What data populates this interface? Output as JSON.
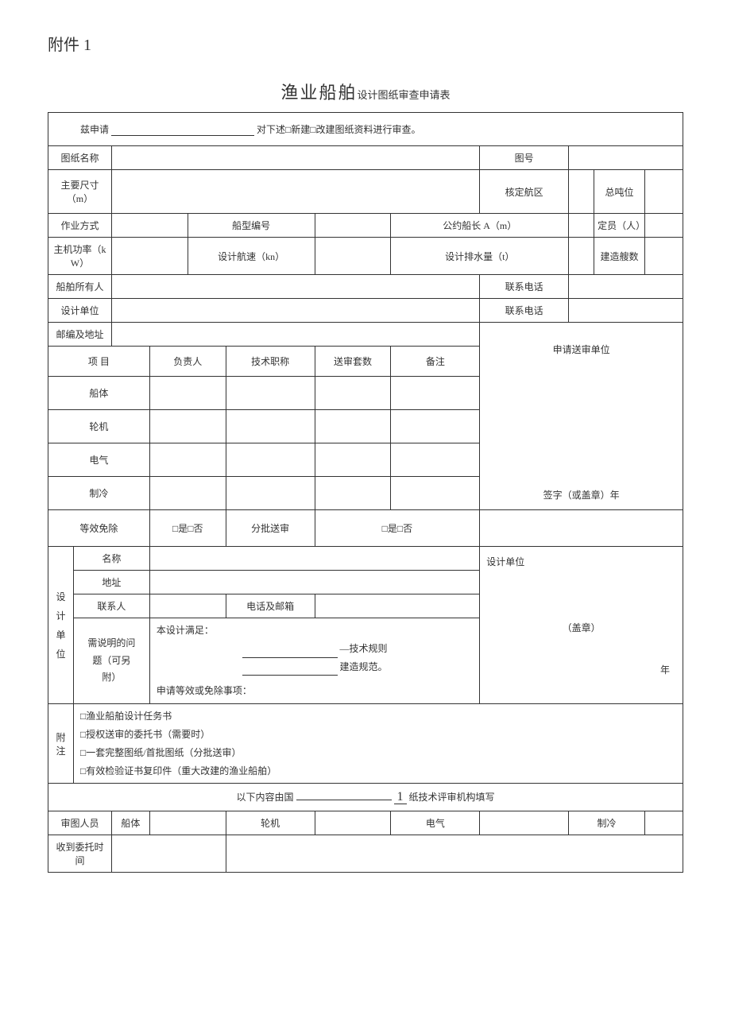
{
  "attachment": "附件 1",
  "title_main": "渔业船舶",
  "title_sub": "设计图纸审查申请表",
  "intro_prefix": "兹申请",
  "intro_suffix": "对下述□新建□改建图纸资料进行审查。",
  "labels": {
    "drawing_name": "图纸名称",
    "drawing_no": "图号",
    "main_dims": "主要尺寸（m）",
    "nav_area": "核定航区",
    "gross_tonnage": "总吨位",
    "work_mode": "作业方式",
    "ship_type_code": "船型编号",
    "convention_length": "公约船长 A（m）",
    "crew": "定员（人）",
    "main_power": "主机功率（kW）",
    "design_speed": "设计航速（kn）",
    "design_displacement": "设计排水量（t）",
    "build_count": "建造艘数",
    "ship_owner": "船舶所有人",
    "contact_phone": "联系电话",
    "design_unit": "设计单位",
    "post_addr": "邮编及地址",
    "item": "项    目",
    "responsible": "负责人",
    "tech_title": "技术职称",
    "review_sets": "送审套数",
    "remark": "备注",
    "hull": "船体",
    "engine": "轮机",
    "electric": "电气",
    "refrig": "制冷",
    "equiv_exempt": "等效免除",
    "yes_no": "□是□否",
    "batch_review": "分批送审",
    "applicant_unit": "申请送审单位",
    "sign_seal": "签字（或盖章）年",
    "design_unit_block": "设计\n单位",
    "name": "名称",
    "addr": "地址",
    "contact": "联系人",
    "phone_email": "电话及邮箱",
    "need_explain": "需说明的问题（可另附）",
    "design_meet": "本设计满足：",
    "tech_rule": "—技术规则",
    "build_spec": "建造规范。",
    "apply_equiv": "申请等效或免除事项：",
    "design_unit_right": "设计单位",
    "seal": "（盖章）",
    "year": "年",
    "attach": "附注",
    "attach1": "□渔业船舶设计任务书",
    "attach2": "□授权送审的委托书（需要时）",
    "attach3": "□一套完整图纸/首批图纸（分批送审）",
    "attach4": "□有效检验证书复印件（重大改建的渔业船舶）",
    "below_prefix": "以下内容由国",
    "below_num": "1",
    "below_suffix": "纸技术评审机构填写",
    "reviewer": "审图人员",
    "receive_time": "收到委托时间"
  }
}
